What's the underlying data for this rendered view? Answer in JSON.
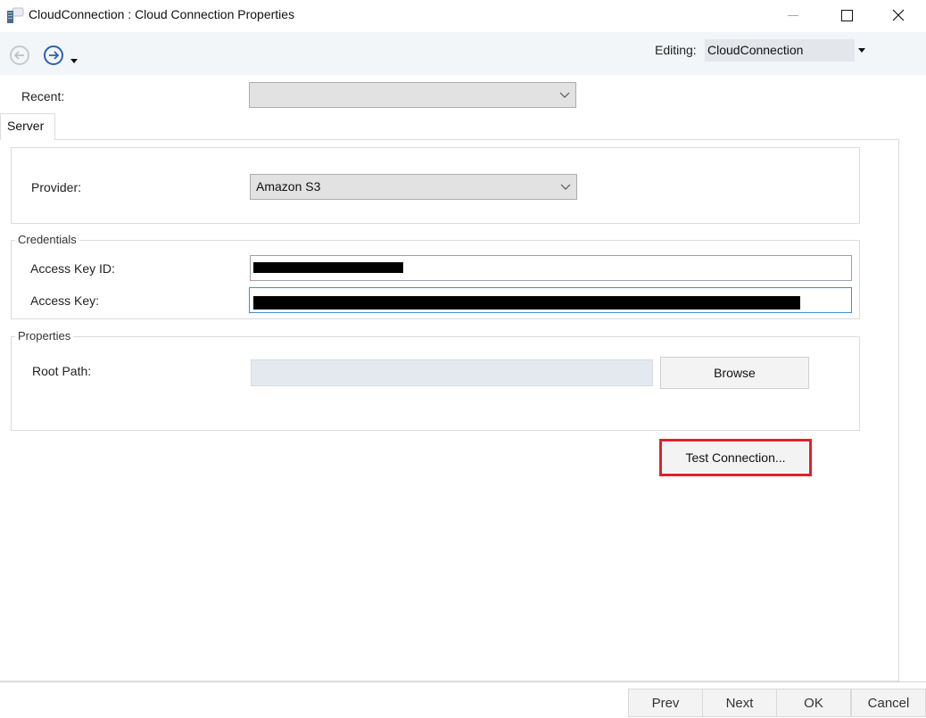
{
  "window": {
    "title": "CloudConnection : Cloud Connection Properties",
    "app_icon": "server-icon",
    "controls": {
      "minimize": "minimize-icon",
      "maximize": "maximize-icon",
      "close": "close-icon"
    }
  },
  "toolbar": {
    "back_icon": "back-arrow-icon",
    "forward_icon": "forward-arrow-icon",
    "dropdown_icon": "caret-down-icon",
    "editing_label": "Editing:",
    "editing_value": "CloudConnection"
  },
  "recent": {
    "label": "Recent:",
    "value": ""
  },
  "tabs": [
    {
      "label": "Server",
      "active": true
    }
  ],
  "server": {
    "provider_label": "Provider:",
    "provider_value": "Amazon S3",
    "credentials": {
      "title": "Credentials",
      "access_key_id_label": "Access Key ID:",
      "access_key_id_value": "[redacted]",
      "access_key_label": "Access Key:",
      "access_key_value": "[redacted]"
    },
    "properties": {
      "title": "Properties",
      "root_path_label": "Root Path:",
      "root_path_value": "",
      "browse_label": "Browse"
    },
    "test_connection_label": "Test Connection..."
  },
  "footer": {
    "prev_label": "Prev",
    "next_label": "Next",
    "ok_label": "OK",
    "cancel_label": "Cancel"
  },
  "colors": {
    "highlight": "#e3202a",
    "focus": "#3c8fd8",
    "forward_icon": "#2a62b0"
  }
}
